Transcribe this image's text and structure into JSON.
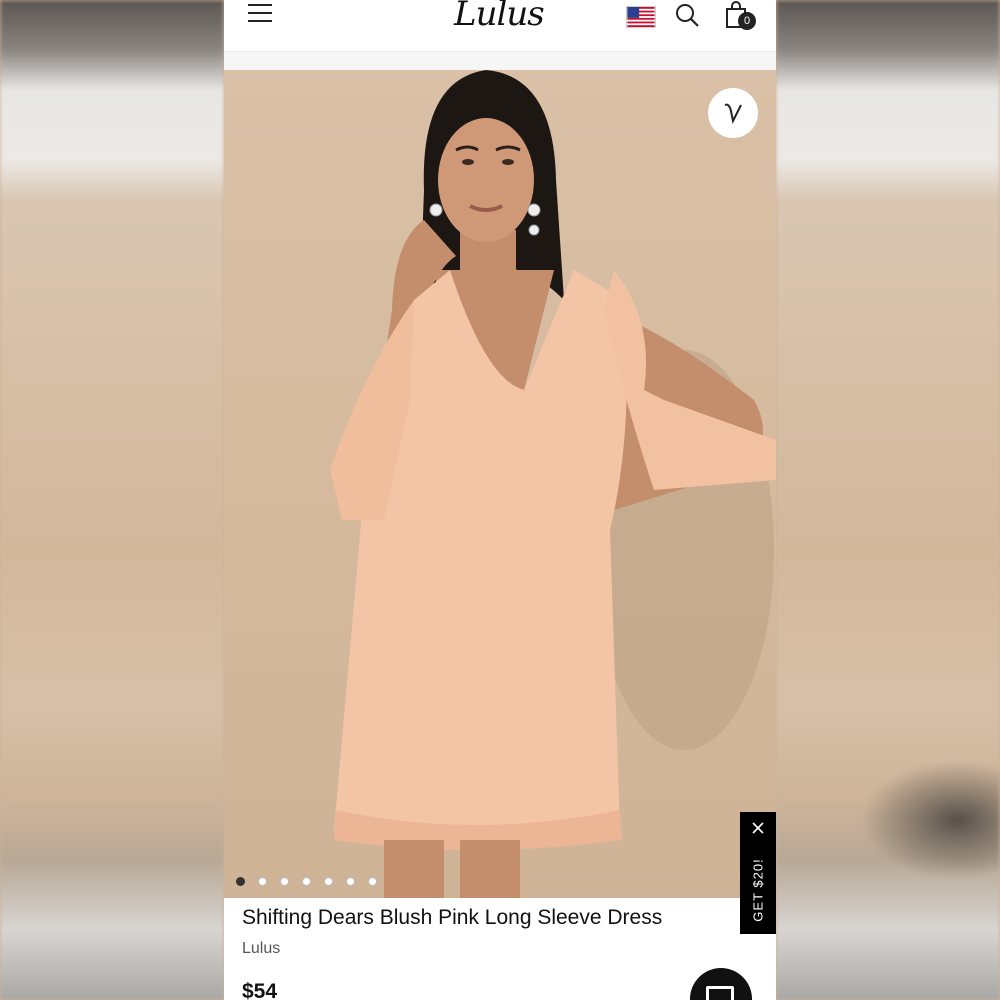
{
  "header": {
    "logo": "Lulus",
    "cart_count": "0"
  },
  "product": {
    "title": "Shifting Dears Blush Pink Long Sleeve Dress",
    "brand": "Lulus",
    "price": "$54",
    "image_count": 7,
    "active_image": 0
  },
  "promo": {
    "label": "GET $20!"
  },
  "colors": {
    "accent": "#111111",
    "dress": "#f3c4a6",
    "background": "#d6bb9f"
  },
  "icons": [
    "menu-icon",
    "us-flag-icon",
    "search-icon",
    "shopping-bag-icon",
    "heart-icon",
    "close-icon",
    "chat-icon"
  ]
}
